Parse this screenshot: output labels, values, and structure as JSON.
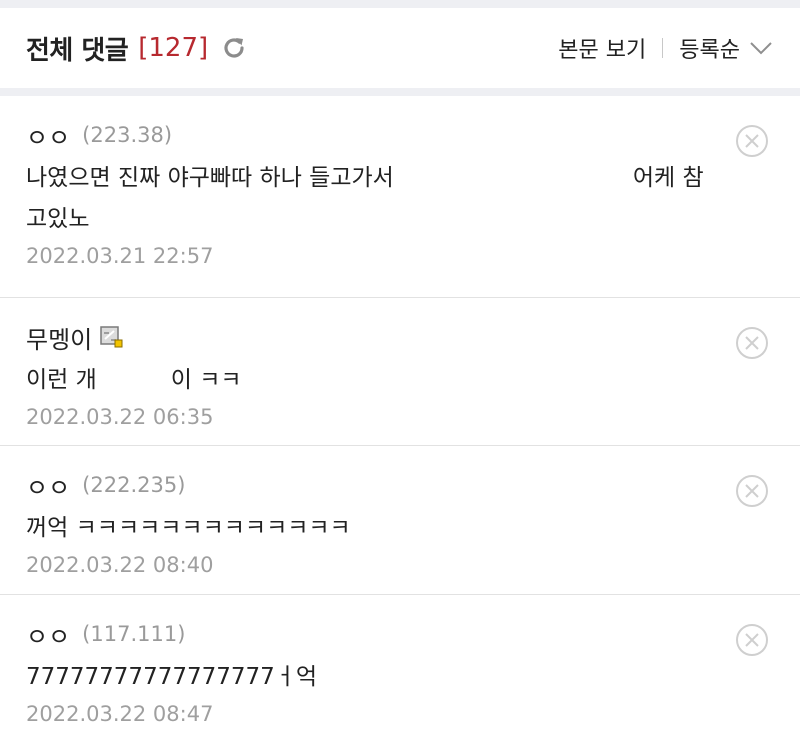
{
  "header": {
    "title": "전체 댓글",
    "count": "[127]",
    "view_post_label": "본문 보기",
    "sort_label": "등록순",
    "refresh_icon": "refresh-icon",
    "sort_icon": "chevron-down-icon"
  },
  "colors": {
    "count": "#b7292f",
    "muted": "#9a9a9a",
    "divider": "#eeeff3"
  },
  "comments": [
    {
      "nick": "ㅇㅇ",
      "ip": "(223.38)",
      "line1": "나였으면 진짜 야구빠따 하나 들고가서",
      "line1b": "어케 참",
      "line2": "고있노",
      "date": "2022.03.21 22:57"
    },
    {
      "nick": "무멩이",
      "ip": "",
      "badge_icon": "member-badge-icon",
      "line1": "이런 개",
      "line1b": "이 ㅋㅋ",
      "date": "2022.03.22 06:35"
    },
    {
      "nick": "ㅇㅇ",
      "ip": "(222.235)",
      "line1": "꺼억 ㅋㅋㅋㅋㅋㅋㅋㅋㅋㅋㅋㅋㅋ",
      "date": "2022.03.22 08:40"
    },
    {
      "nick": "ㅇㅇ",
      "ip": "(117.111)",
      "line1": "77777777777777777ㅓ억",
      "date": "2022.03.22 08:47"
    }
  ]
}
